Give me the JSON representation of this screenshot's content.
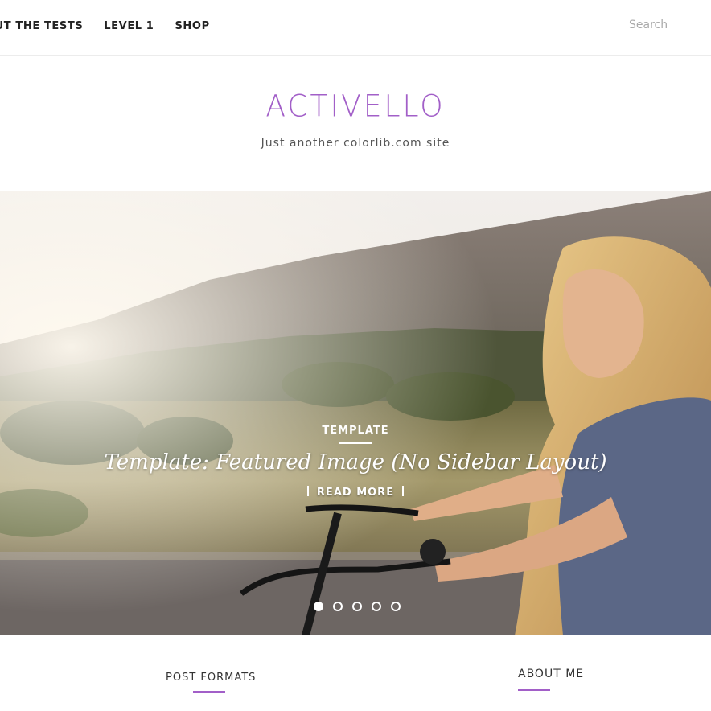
{
  "nav": {
    "items": [
      {
        "label": "OUT THE TESTS"
      },
      {
        "label": "LEVEL 1"
      },
      {
        "label": "SHOP"
      }
    ],
    "search_placeholder": "Search"
  },
  "brand": {
    "title": "ACTIVELLO",
    "tagline": "Just another colorlib.com site"
  },
  "hero": {
    "category": "TEMPLATE",
    "title": "Template: Featured Image (No Sidebar Layout)",
    "read_more": "READ MORE",
    "slides": 5,
    "active_slide": 1
  },
  "sections": {
    "post_formats": "POST FORMATS",
    "about_me": "ABOUT ME"
  },
  "colors": {
    "accent": "#a25fc8",
    "nav_text": "#222222",
    "hero_text": "#ffffff"
  }
}
